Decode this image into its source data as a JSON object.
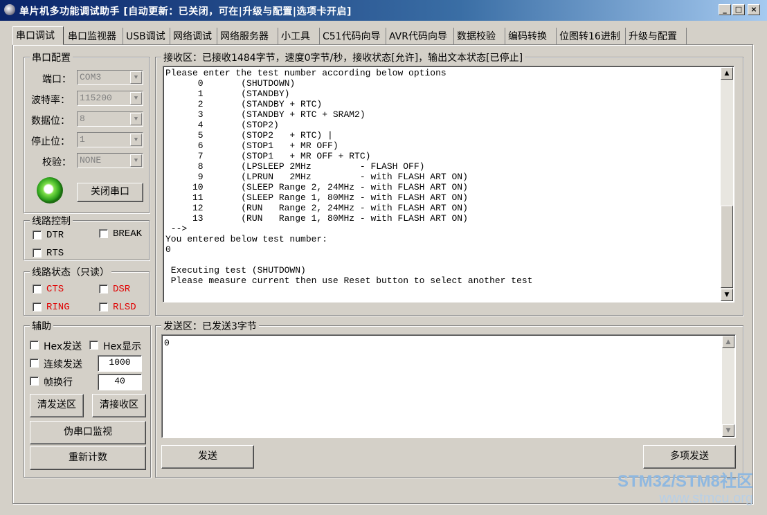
{
  "window": {
    "title": "单片机多功能调试助手 [自动更新：已关闭，可在|升级与配置|选项卡开启]",
    "minimize": "_",
    "maximize": "□",
    "close": "×"
  },
  "tabs": [
    "串口调试",
    "串口监视器",
    "USB调试",
    "网络调试",
    "网络服务器",
    "小工具",
    "C51代码向导",
    "AVR代码向导",
    "数据校验",
    "编码转换",
    "位图转16进制",
    "升级与配置"
  ],
  "serial_config": {
    "group_label": "串口配置",
    "port_label": "端口：",
    "port_value": "COM3",
    "baud_label": "波特率：",
    "baud_value": "115200",
    "databits_label": "数据位：",
    "databits_value": "8",
    "stopbits_label": "停止位：",
    "stopbits_value": "1",
    "parity_label": "校验：",
    "parity_value": "NONE",
    "close_button": "关闭串口"
  },
  "line_control": {
    "group_label": "线路控制",
    "dtr": "DTR",
    "break": "BREAK",
    "rts": "RTS"
  },
  "line_status": {
    "group_label": "线路状态（只读）",
    "cts": "CTS",
    "dsr": "DSR",
    "ring": "RING",
    "rlsd": "RLSD"
  },
  "aux": {
    "group_label": "辅助",
    "hex_send": "Hex发送",
    "hex_display": "Hex显示",
    "continuous_send": "连续发送",
    "continuous_value": "1000",
    "frame_newline": "帧换行",
    "frame_value": "40",
    "clear_send": "清发送区",
    "clear_receive": "清接收区",
    "pseudo_monitor": "伪串口监视",
    "recount": "重新计数"
  },
  "receive": {
    "group_label": "接收区：已接收1484字节，速度0字节/秒，接收状态[允许]，输出文本状态[已停止]",
    "lines": [
      "Please enter the test number according below options",
      "      0       (SHUTDOWN)",
      "      1       (STANDBY)",
      "      2       (STANDBY + RTC)",
      "      3       (STANDBY + RTC + SRAM2)",
      "      4       (STOP2)",
      "      5       (STOP2   + RTC) |",
      "      6       (STOP1   + MR OFF)",
      "      7       (STOP1   + MR OFF + RTC)",
      "      8       (LPSLEEP 2MHz         - FLASH OFF)",
      "      9       (LPRUN   2MHz         - with FLASH ART ON)",
      "     10       (SLEEP Range 2, 24MHz - with FLASH ART ON)",
      "     11       (SLEEP Range 1, 80MHz - with FLASH ART ON)",
      "     12       (RUN   Range 2, 24MHz - with FLASH ART ON)",
      "     13       (RUN   Range 1, 80MHz - with FLASH ART ON)",
      " -->",
      "You entered below test number:",
      "0",
      "",
      " Executing test (SHUTDOWN)",
      " Please measure current then use Reset button to select another test"
    ]
  },
  "send": {
    "group_label": "发送区：已发送3字节",
    "content": "0",
    "send_button": "发送",
    "multi_send_button": "多项发送"
  },
  "watermark": {
    "brand": "STM32/STM8社区",
    "url": "www.stmcu.org"
  }
}
